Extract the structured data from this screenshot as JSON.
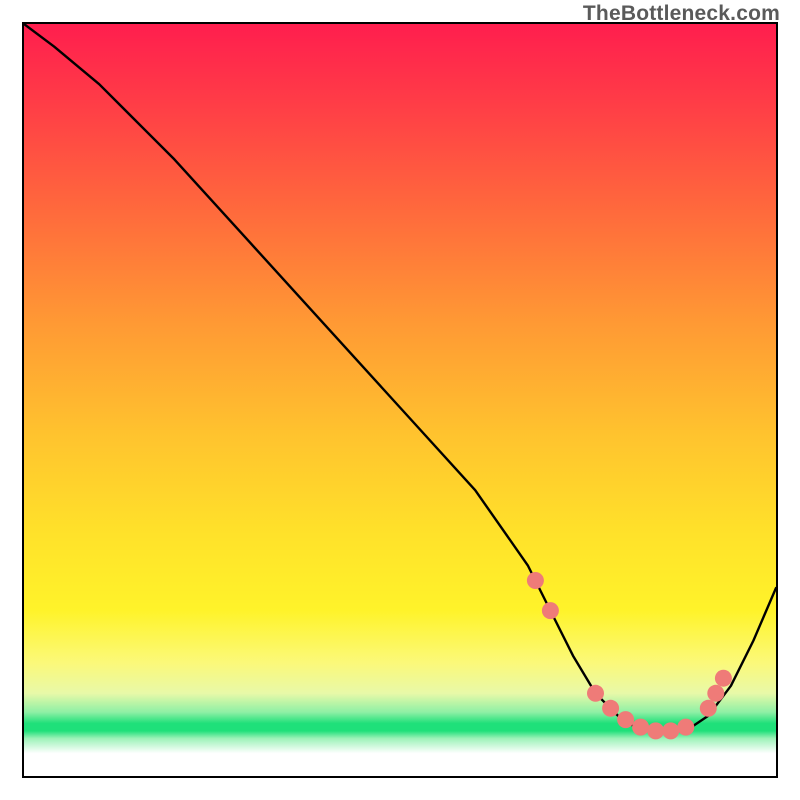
{
  "attribution": "TheBottleneck.com",
  "chart_data": {
    "type": "line",
    "title": "",
    "xlabel": "",
    "ylabel": "",
    "xlim": [
      0,
      100
    ],
    "ylim": [
      0,
      100
    ],
    "grid": false,
    "legend": false,
    "series": [
      {
        "name": "bottleneck-curve",
        "x": [
          0,
          4,
          10,
          20,
          30,
          40,
          50,
          60,
          67,
          70,
          73,
          76,
          80,
          84,
          88,
          91,
          94,
          97,
          100
        ],
        "y": [
          100,
          97,
          92,
          82,
          71,
          60,
          49,
          38,
          28,
          22,
          16,
          11,
          7,
          6,
          6,
          8,
          12,
          18,
          25
        ]
      }
    ],
    "markers": {
      "name": "highlight-dots",
      "color": "#ef7b78",
      "points": [
        {
          "x": 68,
          "y": 26
        },
        {
          "x": 70,
          "y": 22
        },
        {
          "x": 76,
          "y": 11
        },
        {
          "x": 78,
          "y": 9
        },
        {
          "x": 80,
          "y": 7.5
        },
        {
          "x": 82,
          "y": 6.5
        },
        {
          "x": 84,
          "y": 6
        },
        {
          "x": 86,
          "y": 6
        },
        {
          "x": 88,
          "y": 6.5
        },
        {
          "x": 91,
          "y": 9
        },
        {
          "x": 92,
          "y": 11
        },
        {
          "x": 93,
          "y": 13
        }
      ]
    },
    "background_gradient_stops": [
      {
        "pos": 0.0,
        "color": "#ff1e4e"
      },
      {
        "pos": 0.55,
        "color": "#ffe22a"
      },
      {
        "pos": 0.93,
        "color": "#1fe07a"
      },
      {
        "pos": 1.0,
        "color": "#ffffff"
      }
    ]
  }
}
